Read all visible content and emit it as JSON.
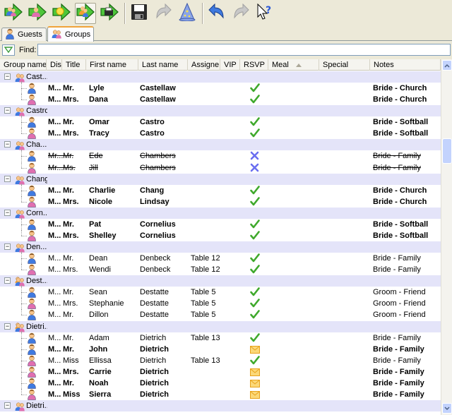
{
  "toolbar": {
    "buttons": [
      {
        "name": "add-guests-icon",
        "state": "normal"
      },
      {
        "name": "import-guest-icon",
        "state": "normal"
      },
      {
        "name": "export-guest-icon",
        "state": "normal"
      },
      {
        "name": "assign-group-icon",
        "state": "pressed"
      },
      {
        "name": "print-guest-icon",
        "state": "normal"
      },
      {
        "name": "save-icon",
        "state": "normal"
      },
      {
        "name": "redo-icon",
        "state": "disabled"
      },
      {
        "name": "wizard-icon",
        "state": "normal"
      },
      {
        "name": "undo-icon",
        "state": "normal"
      },
      {
        "name": "redo-arrow-icon",
        "state": "disabled"
      },
      {
        "name": "help-icon",
        "state": "normal"
      }
    ]
  },
  "tabs": [
    {
      "label": "Guests",
      "active": false
    },
    {
      "label": "Groups",
      "active": true
    }
  ],
  "find": {
    "label": "Find:",
    "value": ""
  },
  "columns": [
    "Group name",
    "Disp",
    "Title",
    "First name",
    "Last name",
    "Assigne",
    "VIP",
    "RSVP",
    "Meal",
    "Special",
    "Notes"
  ],
  "sort": {
    "column": "Meal",
    "direction": "ascending"
  },
  "rows": [
    {
      "type": "group",
      "name": "Cast...",
      "icon": "couple"
    },
    {
      "type": "guest",
      "gender": "m",
      "disp": "M...",
      "title": "Mr.",
      "first": "Lyle",
      "last": "Castellaw",
      "assigned": "",
      "rsvp": "yes",
      "notes": "Bride - Church",
      "bold": true,
      "strike": false
    },
    {
      "type": "guest",
      "gender": "f",
      "disp": "M...",
      "title": "Mrs.",
      "first": "Dana",
      "last": "Castellaw",
      "assigned": "",
      "rsvp": "yes",
      "notes": "Bride - Church",
      "bold": true,
      "strike": false
    },
    {
      "type": "group",
      "name": "Castro",
      "icon": "couple"
    },
    {
      "type": "guest",
      "gender": "m",
      "disp": "M...",
      "title": "Mr.",
      "first": "Omar",
      "last": "Castro",
      "assigned": "",
      "rsvp": "yes",
      "notes": "Bride - Softball",
      "bold": true,
      "strike": false
    },
    {
      "type": "guest",
      "gender": "f",
      "disp": "M...",
      "title": "Mrs.",
      "first": "Tracy",
      "last": "Castro",
      "assigned": "",
      "rsvp": "yes",
      "notes": "Bride - Softball",
      "bold": true,
      "strike": false
    },
    {
      "type": "group",
      "name": "Cha...",
      "icon": "couple"
    },
    {
      "type": "guest",
      "gender": "m",
      "disp": "Mr...",
      "title": "Mr.",
      "first": "Ede",
      "last": "Chambers",
      "assigned": "",
      "rsvp": "no",
      "notes": "Bride - Family",
      "bold": false,
      "strike": true
    },
    {
      "type": "guest",
      "gender": "f",
      "disp": "Mr...",
      "title": "Ms.",
      "first": "Jill",
      "last": "Chambers",
      "assigned": "",
      "rsvp": "no",
      "notes": "Bride - Family",
      "bold": false,
      "strike": true
    },
    {
      "type": "group",
      "name": "Chang",
      "icon": "couple"
    },
    {
      "type": "guest",
      "gender": "m",
      "disp": "M...",
      "title": "Mr.",
      "first": "Charlie",
      "last": "Chang",
      "assigned": "",
      "rsvp": "yes",
      "notes": "Bride - Church",
      "bold": true,
      "strike": false
    },
    {
      "type": "guest",
      "gender": "f",
      "disp": "M...",
      "title": "Mrs.",
      "first": "Nicole",
      "last": "Lindsay",
      "assigned": "",
      "rsvp": "yes",
      "notes": "Bride - Church",
      "bold": true,
      "strike": false
    },
    {
      "type": "group",
      "name": "Corn...",
      "icon": "couple"
    },
    {
      "type": "guest",
      "gender": "m",
      "disp": "M...",
      "title": "Mr.",
      "first": "Pat",
      "last": "Cornelius",
      "assigned": "",
      "rsvp": "yes",
      "notes": "Bride - Softball",
      "bold": true,
      "strike": false
    },
    {
      "type": "guest",
      "gender": "f",
      "disp": "M...",
      "title": "Mrs.",
      "first": "Shelley",
      "last": "Cornelius",
      "assigned": "",
      "rsvp": "yes",
      "notes": "Bride - Softball",
      "bold": true,
      "strike": false
    },
    {
      "type": "group",
      "name": "Den...",
      "icon": "couple"
    },
    {
      "type": "guest",
      "gender": "m",
      "disp": "M...",
      "title": "Mr.",
      "first": "Dean",
      "last": "Denbeck",
      "assigned": "Table 12",
      "rsvp": "yes",
      "notes": "Bride - Family",
      "bold": false,
      "strike": false
    },
    {
      "type": "guest",
      "gender": "f",
      "disp": "M...",
      "title": "Mrs.",
      "first": "Wendi",
      "last": "Denbeck",
      "assigned": "Table 12",
      "rsvp": "yes",
      "notes": "Bride - Family",
      "bold": false,
      "strike": false
    },
    {
      "type": "group",
      "name": "Dest...",
      "icon": "family"
    },
    {
      "type": "guest",
      "gender": "m",
      "disp": "M...",
      "title": "Mr.",
      "first": "Sean",
      "last": "Destatte",
      "assigned": "Table 5",
      "rsvp": "yes",
      "notes": "Groom - Friend",
      "bold": false,
      "strike": false
    },
    {
      "type": "guest",
      "gender": "f",
      "disp": "M...",
      "title": "Mrs.",
      "first": "Stephanie",
      "last": "Destatte",
      "assigned": "Table 5",
      "rsvp": "yes",
      "notes": "Groom - Friend",
      "bold": false,
      "strike": false
    },
    {
      "type": "guest",
      "gender": "m",
      "disp": "M...",
      "title": "Mr.",
      "first": "Dillon",
      "last": "Destatte",
      "assigned": "Table 5",
      "rsvp": "yes",
      "notes": "Groom - Friend",
      "bold": false,
      "strike": false
    },
    {
      "type": "group",
      "name": "Dietri...",
      "icon": "family"
    },
    {
      "type": "guest",
      "gender": "m",
      "disp": "M...",
      "title": "Mr.",
      "first": "Adam",
      "last": "Dietrich",
      "assigned": "Table 13",
      "rsvp": "yes",
      "notes": "Bride - Family",
      "bold": false,
      "strike": false
    },
    {
      "type": "guest",
      "gender": "m",
      "disp": "M...",
      "title": "Mr.",
      "first": "John",
      "last": "Dietrich",
      "assigned": "",
      "rsvp": "mail",
      "notes": "Bride - Family",
      "bold": true,
      "strike": false
    },
    {
      "type": "guest",
      "gender": "f",
      "disp": "M...",
      "title": "Miss",
      "first": "Ellissa",
      "last": "Dietrich",
      "assigned": "Table 13",
      "rsvp": "yes",
      "notes": "Bride - Family",
      "bold": false,
      "strike": false
    },
    {
      "type": "guest",
      "gender": "f",
      "disp": "M...",
      "title": "Mrs.",
      "first": "Carrie",
      "last": "Dietrich",
      "assigned": "",
      "rsvp": "mail",
      "notes": "Bride - Family",
      "bold": true,
      "strike": false
    },
    {
      "type": "guest",
      "gender": "m",
      "disp": "M...",
      "title": "Mr.",
      "first": "Noah",
      "last": "Dietrich",
      "assigned": "",
      "rsvp": "mail",
      "notes": "Bride - Family",
      "bold": true,
      "strike": false
    },
    {
      "type": "guest",
      "gender": "f",
      "disp": "M...",
      "title": "Miss",
      "first": "Sierra",
      "last": "Dietrich",
      "assigned": "",
      "rsvp": "mail",
      "notes": "Bride - Family",
      "bold": true,
      "strike": false
    },
    {
      "type": "group",
      "name": "Dietri...",
      "icon": "couple"
    }
  ],
  "colors": {
    "stripe": "#e4e4f9",
    "check": "#3fa92c",
    "cross": "#6a6ef0",
    "mail": "#e8a21a",
    "tab_accent": "#f0a33a"
  }
}
